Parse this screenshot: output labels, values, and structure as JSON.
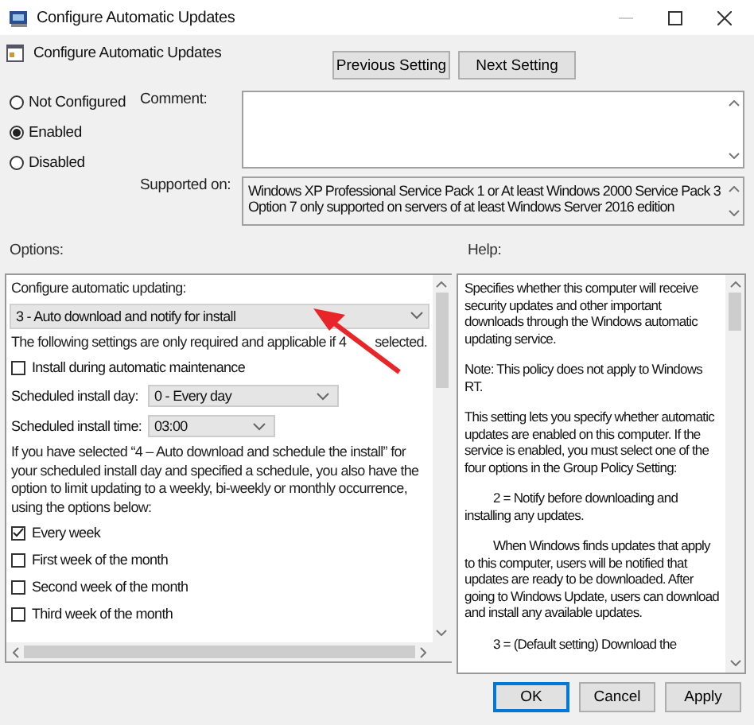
{
  "window": {
    "title": "Configure Automatic Updates"
  },
  "header": {
    "title": "Configure Automatic Updates",
    "buttons": [
      "Previous Setting",
      "Next Setting"
    ]
  },
  "states": [
    {
      "label": "Not Configured",
      "selected": false
    },
    {
      "label": "Enabled",
      "selected": true
    },
    {
      "label": "Disabled",
      "selected": false
    }
  ],
  "comment": {
    "label": "Comment:"
  },
  "supported_on": {
    "label": "Supported on:",
    "value": "Windows XP Professional Service Pack 1 or At least Windows 2000 Service Pack 3 Option 7 only supported on servers of at least Windows Server 2016 edition"
  },
  "options": {
    "label": "Options:",
    "items": [
      {
        "kind": "label",
        "text": "Configure automatic updating:"
      },
      {
        "kind": "dropdown",
        "value": "3 - Auto download and notify for install"
      },
      {
        "kind": "covered_label",
        "before": "The following settings are only required and applicable if 4",
        "after": "selected."
      },
      {
        "kind": "checkbox",
        "text": "Install during automatic maintenance",
        "checked": false
      },
      {
        "kind": "field",
        "text": "Scheduled install day:",
        "value": "0 - Every day"
      },
      {
        "kind": "field",
        "text": "Scheduled install time:",
        "value": "03:00"
      },
      {
        "kind": "label",
        "text": "If you have selected “4 – Auto download and schedule the install” for your scheduled install day and specified a schedule, you also have the option to limit updating to a weekly, bi-weekly or monthly occurrence, using the options below:"
      },
      {
        "kind": "checkbox",
        "text": "Every week",
        "checked": true
      },
      {
        "kind": "checkbox",
        "text": "First week of the month",
        "checked": false
      },
      {
        "kind": "checkbox",
        "text": "Second week of the month",
        "checked": false
      },
      {
        "kind": "checkbox",
        "text": "Third week of the month",
        "checked": false
      }
    ]
  },
  "help": {
    "label": "Help:",
    "paragraphs": [
      {
        "text": "Specifies whether this computer will receive security updates and other important downloads through the Windows automatic updating service.",
        "indent": false
      },
      {
        "text": "Note: This policy does not apply to Windows RT.",
        "indent": false
      },
      {
        "text": "This setting lets you specify whether automatic updates are enabled on this computer. If the service is enabled, you must select one of the four options in the Group Policy Setting:",
        "indent": false
      },
      {
        "text": "2 = Notify before downloading and installing any updates.",
        "indent": true
      },
      {
        "text": "When Windows finds updates that apply to this computer, users will be notified that updates are ready to be downloaded. After going to Windows Update, users can download and install any available updates.",
        "indent": true
      },
      {
        "text": "3 = (Default setting) Download the",
        "indent": true
      }
    ]
  },
  "buttons": [
    {
      "label": "OK",
      "default": true
    },
    {
      "label": "Cancel",
      "default": false
    },
    {
      "label": "Apply",
      "default": false
    }
  ]
}
